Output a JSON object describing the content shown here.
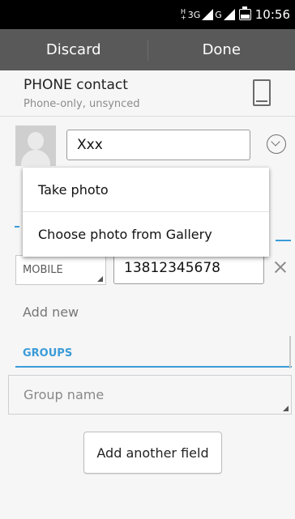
{
  "status_bar": {
    "network": "3G",
    "sim2": "G",
    "hplus": "H",
    "time": "10:56"
  },
  "action_bar": {
    "discard_label": "Discard",
    "done_label": "Done"
  },
  "account": {
    "title": "PHONE contact",
    "subtitle": "Phone-only, unsynced",
    "icon": "phone-icon"
  },
  "name": {
    "value": "Xxx"
  },
  "phone": {
    "type": "MOBILE",
    "number": "13812345678",
    "add_new": "Add new"
  },
  "groups": {
    "header": "GROUPS",
    "placeholder": "Group name"
  },
  "add_field_label": "Add another field",
  "popup_menu": {
    "items": [
      "Take photo",
      "Choose photo from Gallery"
    ]
  },
  "colors": {
    "accent": "#3b9bd8",
    "action_bar": "#595959",
    "background": "#f6f6f6"
  }
}
